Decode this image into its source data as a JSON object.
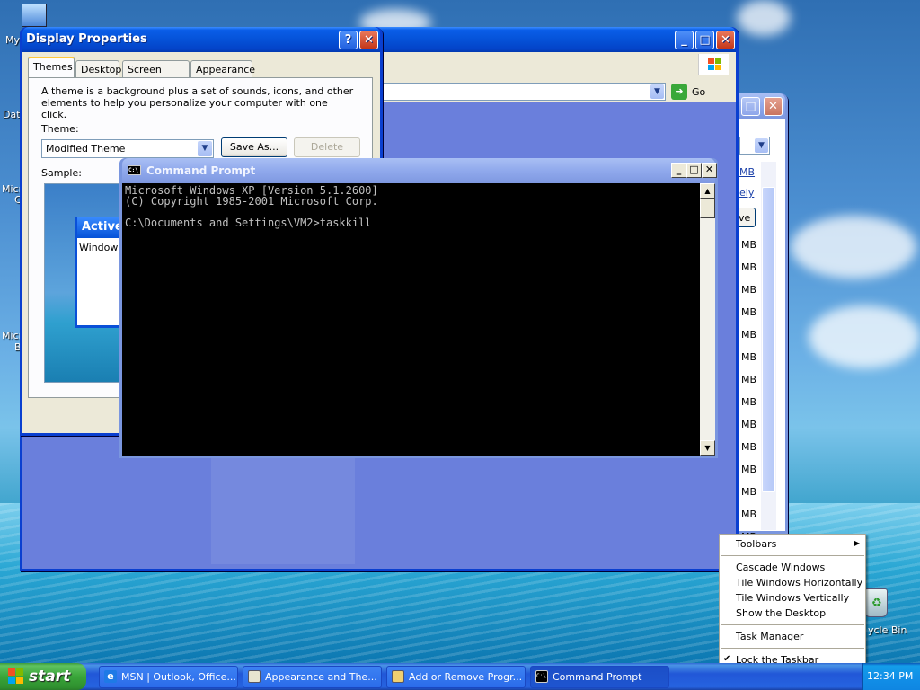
{
  "desktop": {
    "icons": [
      {
        "label": "My",
        "icon": "my-documents-icon"
      },
      {
        "label": "Dat",
        "icon": "data-icon"
      },
      {
        "label": "Micro",
        "icon": "microsoft-icon"
      },
      {
        "label": "C",
        "icon": ""
      },
      {
        "label": "Micro",
        "icon": "microsoft-icon"
      },
      {
        "label": "B",
        "icon": ""
      },
      {
        "label": "ycle Bin",
        "icon": "recycle-bin-icon"
      }
    ]
  },
  "display_properties": {
    "title": "Display Properties",
    "help_btn": "?",
    "close_btn": "✕",
    "tabs": [
      {
        "label": "Themes",
        "active": true
      },
      {
        "label": "Desktop",
        "active": false
      },
      {
        "label": "Screen Saver",
        "active": false
      },
      {
        "label": "Appearance",
        "active": false
      }
    ],
    "description": "A theme is a background plus a set of sounds, icons, and other elements to help you personalize your computer with one click.",
    "theme_label": "Theme:",
    "theme_value": "Modified Theme",
    "save_as": "Save As...",
    "delete": "Delete",
    "sample_label": "Sample:",
    "preview_active": "Active",
    "preview_window_text": "Window T"
  },
  "explorer_window": {
    "go_label": "Go",
    "minimize": "_",
    "maximize": "□",
    "close": "✕"
  },
  "back_window": {
    "sizes": [
      "MB",
      "MB",
      "MB",
      "MB",
      "MB",
      "MB",
      "MB",
      "MB",
      "MB",
      "MB",
      "MB",
      "MB",
      "MB",
      "MB",
      "MB",
      "MB"
    ],
    "link1": "MB",
    "link2": "ely",
    "btn": "ve"
  },
  "command_prompt": {
    "title": "Command Prompt",
    "icon": "C:\\",
    "minimize": "_",
    "maximize": "□",
    "close": "✕",
    "lines": [
      "Microsoft Windows XP [Version 5.1.2600]",
      "(C) Copyright 1985-2001 Microsoft Corp.",
      "",
      "C:\\Documents and Settings\\VM2>taskkill"
    ]
  },
  "context_menu": {
    "items": [
      {
        "label": "Toolbars",
        "submenu": true
      },
      {
        "sep": true
      },
      {
        "label": "Cascade Windows"
      },
      {
        "label": "Tile Windows Horizontally"
      },
      {
        "label": "Tile Windows Vertically"
      },
      {
        "label": "Show the Desktop"
      },
      {
        "sep": true
      },
      {
        "label": "Task Manager"
      },
      {
        "sep": true
      },
      {
        "label": "Lock the Taskbar",
        "checked": true
      },
      {
        "label": "Properties"
      }
    ]
  },
  "taskbar": {
    "start_label": "start",
    "tasks": [
      {
        "label": "MSN | Outlook, Office...",
        "icon": "ie-icon"
      },
      {
        "label": "Appearance and The...",
        "icon": "control-panel-icon"
      },
      {
        "label": "Add or Remove Progr...",
        "icon": "add-remove-icon"
      },
      {
        "label": "Command Prompt",
        "icon": "cmd-icon"
      }
    ],
    "clock": "12:34 PM"
  },
  "colors": {
    "xp_blue": "#0a5ee8",
    "start_green": "#39a539",
    "desktop_sky": "#4c8fd1"
  }
}
